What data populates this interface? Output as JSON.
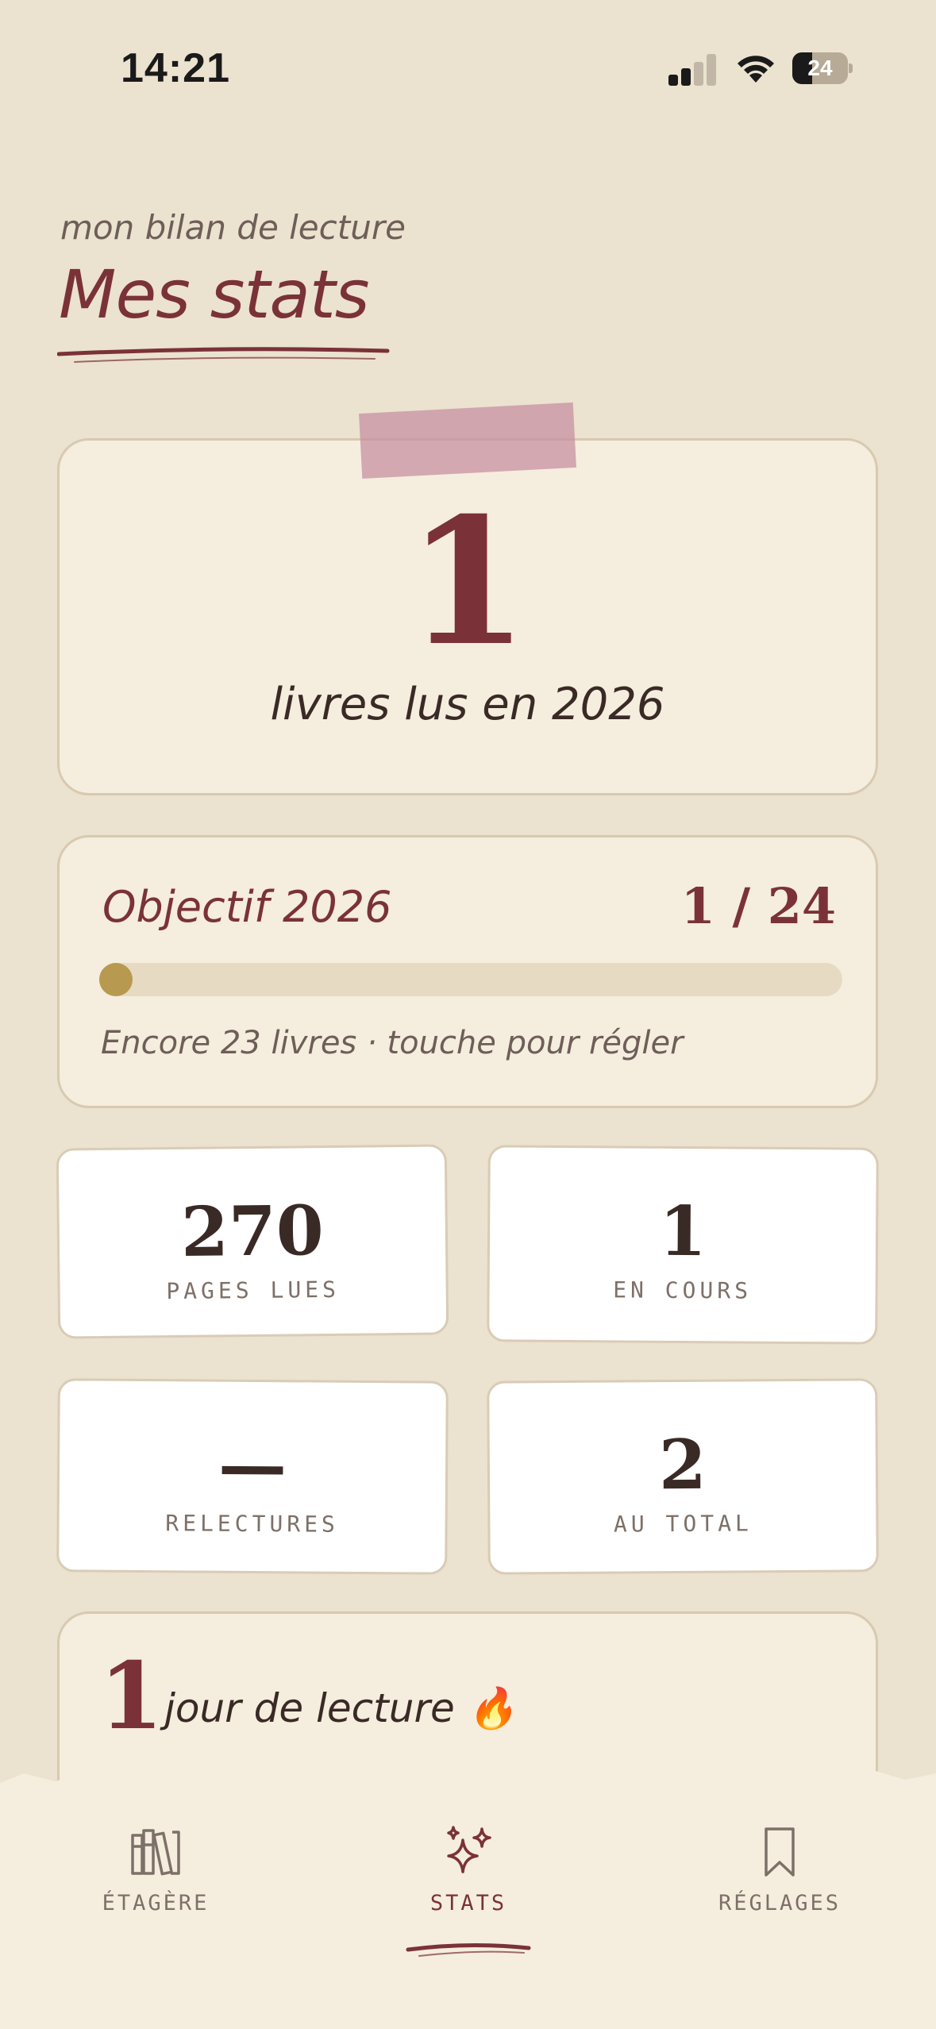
{
  "status_bar": {
    "time": "14:21",
    "battery_level": "24",
    "battery_fraction": 0.24,
    "signal_bars_active": 2
  },
  "header": {
    "subtitle": "mon bilan de lecture",
    "title": "Mes stats"
  },
  "hero": {
    "count": "1",
    "label": "livres lus en 2026"
  },
  "goal": {
    "title": "Objectif 2026",
    "value": "1 / 24",
    "progress_fraction": 0.0417,
    "hint": "Encore 23 livres · touche pour régler"
  },
  "stats": [
    {
      "value": "270",
      "label": "PAGES LUES"
    },
    {
      "value": "1",
      "label": "EN COURS"
    },
    {
      "value": "—",
      "label": "RELECTURES"
    },
    {
      "value": "2",
      "label": "AU TOTAL"
    }
  ],
  "streak": {
    "count": "1",
    "label": "jour de lecture 🔥"
  },
  "tabs": [
    {
      "label": "ÉTAGÈRE",
      "icon": "books-icon",
      "active": false
    },
    {
      "label": "STATS",
      "icon": "sparkles-icon",
      "active": true
    },
    {
      "label": "RÉGLAGES",
      "icon": "bookmark-icon",
      "active": false
    }
  ],
  "colors": {
    "background": "#ebe2cf",
    "card": "#f5eddd",
    "accent": "#7a3238",
    "progress": "#b7994f",
    "tape": "#c68ea0",
    "muted": "#7d7068"
  }
}
